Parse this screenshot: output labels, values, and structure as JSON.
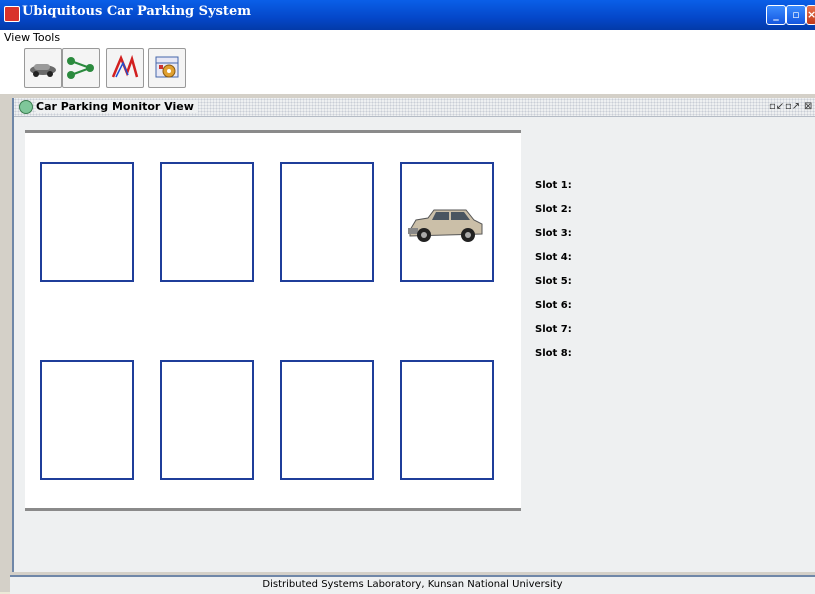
{
  "window": {
    "title": "Ubiquitous Car Parking System"
  },
  "menu": {
    "view": "View",
    "tools": "Tools"
  },
  "toolbar": {
    "buttons": [
      "car-icon",
      "network-icon",
      "chart-icon",
      "settings-calendar-icon"
    ]
  },
  "internal_frame": {
    "title": "Car Parking Monitor View"
  },
  "parking": {
    "slots": [
      {
        "id": 1,
        "occupied": false
      },
      {
        "id": 2,
        "occupied": false
      },
      {
        "id": 3,
        "occupied": false
      },
      {
        "id": 4,
        "occupied": true
      },
      {
        "id": 5,
        "occupied": false
      },
      {
        "id": 6,
        "occupied": false
      },
      {
        "id": 7,
        "occupied": false
      },
      {
        "id": 8,
        "occupied": false
      }
    ],
    "labels": [
      "Slot 1:",
      "Slot 2:",
      "Slot 3:",
      "Slot 4:",
      "Slot 5:",
      "Slot 6:",
      "Slot 7:",
      "Slot 8:"
    ]
  },
  "status": {
    "text": "Distributed Systems Laboratory, Kunsan National University"
  }
}
